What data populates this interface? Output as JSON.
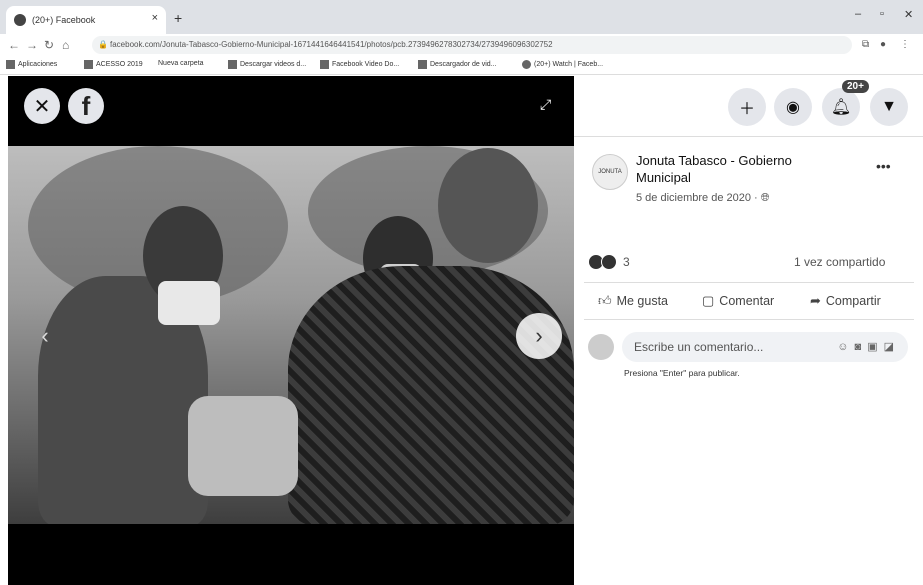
{
  "browser": {
    "tab_title": "(20+) Facebook",
    "tab_close": "×",
    "new_tab": "+",
    "url": "facebook.com/Jonuta-Tabasco-Gobierno-Municipal-1671441646441541/photos/pcb.2739496278302734/2739496096302752",
    "bookmarks": [
      {
        "label": "Aplicaciones"
      },
      {
        "label": "ACESSO 2019"
      },
      {
        "label": "Nueva carpeta"
      },
      {
        "label": "Descargar videos d..."
      },
      {
        "label": "Facebook Video Do..."
      },
      {
        "label": "Descargador de vid..."
      },
      {
        "label": "(20+) Watch | Faceb..."
      }
    ]
  },
  "viewer": {
    "close": "✕",
    "logo": "f",
    "prev": "‹",
    "next": "›"
  },
  "header": {
    "notifications_badge": "20+"
  },
  "post": {
    "page_name": "Jonuta Tabasco - Gobierno Municipal",
    "avatar_text": "JONUTA",
    "date": "5 de diciembre de 2020 · ",
    "reaction_count": "3",
    "shares": "1 vez compartido",
    "like_label": "Me gusta",
    "comment_label": "Comentar",
    "share_label": "Compartir",
    "comment_placeholder": "Escribe un comentario...",
    "comment_hint": "Presiona \"Enter\" para publicar."
  },
  "icons": {
    "close": "close-icon",
    "facebook": "facebook-logo-icon",
    "expand": "expand-icon",
    "plus": "plus-icon",
    "messenger": "messenger-icon",
    "bell": "bell-icon",
    "caret": "caret-down-icon",
    "globe": "globe-icon",
    "like": "thumbs-up-icon",
    "comment": "comment-icon",
    "share": "share-icon"
  }
}
